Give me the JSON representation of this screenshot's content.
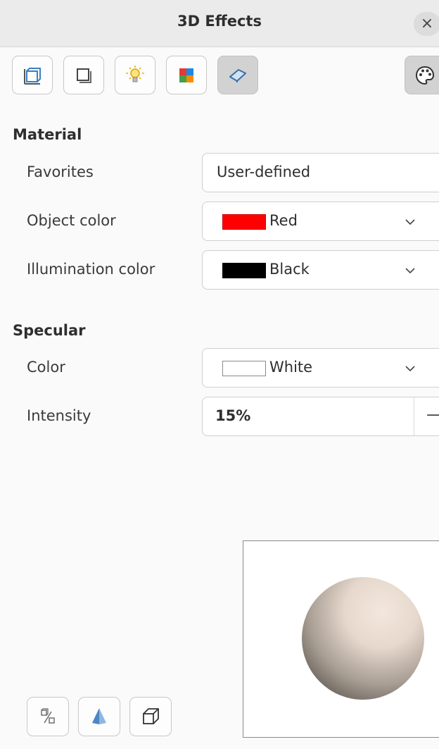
{
  "window": {
    "title": "3D Effects",
    "close_symbol": "×"
  },
  "toolbar": {
    "buttons": [
      {
        "name": "geometry",
        "icon": "geometry-icon"
      },
      {
        "name": "shading",
        "icon": "shading-icon"
      },
      {
        "name": "illumination",
        "icon": "lightbulb-icon"
      },
      {
        "name": "textures",
        "icon": "textures-icon"
      },
      {
        "name": "material",
        "icon": "material-icon",
        "active": true
      }
    ],
    "assign": {
      "icon": "palette-icon"
    }
  },
  "material": {
    "heading": "Material",
    "favorites": {
      "label": "Favorites",
      "value": "User-defined"
    },
    "object_color": {
      "label": "Object color",
      "value": "Red",
      "swatch": "#ff0000"
    },
    "illumination_color": {
      "label": "Illumination color",
      "value": "Black",
      "swatch": "#000000"
    }
  },
  "specular": {
    "heading": "Specular",
    "color": {
      "label": "Color",
      "value": "White",
      "swatch": "#ffffff"
    },
    "intensity": {
      "label": "Intensity",
      "value": "15%",
      "decrement_symbol": "—"
    }
  },
  "preview": {
    "shape": "sphere"
  },
  "bottom_buttons": [
    {
      "name": "convert-to-3d",
      "icon": "convert-3d-icon"
    },
    {
      "name": "convert-to-lathe",
      "icon": "cone-icon"
    },
    {
      "name": "perspective",
      "icon": "perspective-cube-icon"
    }
  ]
}
